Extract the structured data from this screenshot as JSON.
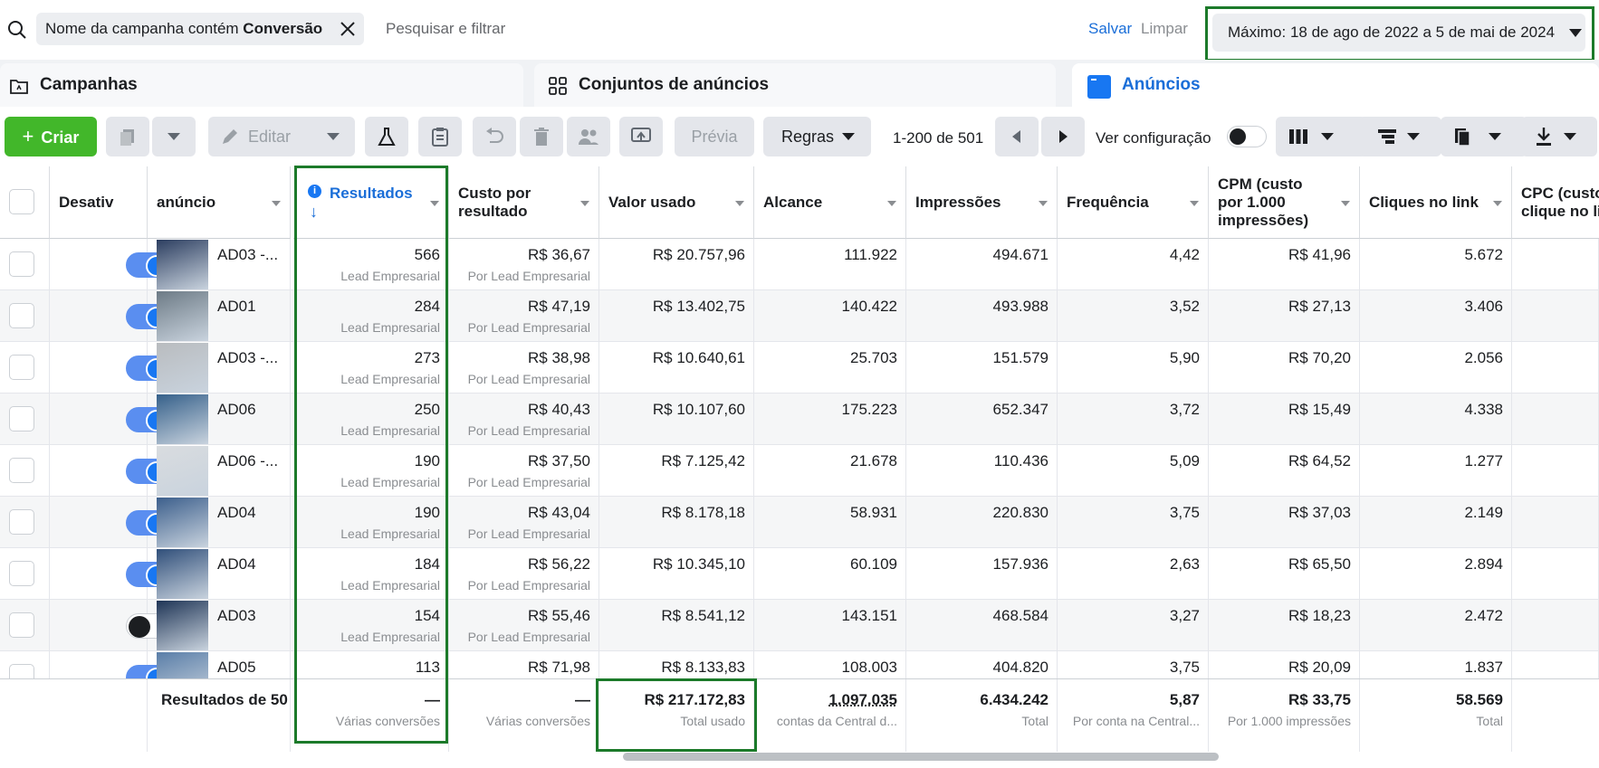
{
  "filter": {
    "chip_prefix": "Nome da campanha contém ",
    "chip_value": "Conversão",
    "search_placeholder": "Pesquisar e filtrar",
    "save": "Salvar",
    "clear": "Limpar",
    "date_range": "Máximo: 18 de ago de 2022 a 5 de mai de 2024"
  },
  "tabs": [
    {
      "label": "Campanhas",
      "icon": "folder-icon"
    },
    {
      "label": "Conjuntos de anúncios",
      "icon": "grid-icon"
    },
    {
      "label": "Anúncios",
      "icon": "ad-icon",
      "active": true
    }
  ],
  "toolbar": {
    "create": "Criar",
    "edit": "Editar",
    "preview": "Prévia",
    "rules": "Regras",
    "pager": "1-200 de 501",
    "view_settings": "Ver configuração"
  },
  "columns": {
    "toggle": "Desativ",
    "ad": "anúncio",
    "results": "Resultados",
    "cost_per_result_1": "Custo por",
    "cost_per_result_2": "resultado",
    "spent": "Valor usado",
    "reach": "Alcance",
    "impressions": "Impressões",
    "frequency": "Frequência",
    "cpm_1": "CPM (custo",
    "cpm_2": "por 1.000",
    "cpm_3": "impressões)",
    "link_clicks": "Cliques no link",
    "cpc_1": "CPC (custo",
    "cpc_2": "clique no li"
  },
  "rows": [
    {
      "on": true,
      "name": "AD03 -...",
      "results": "566",
      "results_sub": "Lead Empresarial",
      "cpr": "R$ 36,67",
      "cpr_sub": "Por Lead Empresarial",
      "spent": "R$ 20.757,96",
      "reach": "111.922",
      "impr": "494.671",
      "freq": "4,42",
      "cpm": "R$ 41,96",
      "clicks": "5.672"
    },
    {
      "on": true,
      "name": "AD01",
      "results": "284",
      "results_sub": "Lead Empresarial",
      "cpr": "R$ 47,19",
      "cpr_sub": "Por Lead Empresarial",
      "spent": "R$ 13.402,75",
      "reach": "140.422",
      "impr": "493.988",
      "freq": "3,52",
      "cpm": "R$ 27,13",
      "clicks": "3.406"
    },
    {
      "on": true,
      "name": "AD03 -...",
      "results": "273",
      "results_sub": "Lead Empresarial",
      "cpr": "R$ 38,98",
      "cpr_sub": "Por Lead Empresarial",
      "spent": "R$ 10.640,61",
      "reach": "25.703",
      "impr": "151.579",
      "freq": "5,90",
      "cpm": "R$ 70,20",
      "clicks": "2.056"
    },
    {
      "on": true,
      "name": "AD06",
      "results": "250",
      "results_sub": "Lead Empresarial",
      "cpr": "R$ 40,43",
      "cpr_sub": "Por Lead Empresarial",
      "spent": "R$ 10.107,60",
      "reach": "175.223",
      "impr": "652.347",
      "freq": "3,72",
      "cpm": "R$ 15,49",
      "clicks": "4.338"
    },
    {
      "on": true,
      "name": "AD06 -...",
      "results": "190",
      "results_sub": "Lead Empresarial",
      "cpr": "R$ 37,50",
      "cpr_sub": "Por Lead Empresarial",
      "spent": "R$ 7.125,42",
      "reach": "21.678",
      "impr": "110.436",
      "freq": "5,09",
      "cpm": "R$ 64,52",
      "clicks": "1.277"
    },
    {
      "on": true,
      "name": "AD04",
      "results": "190",
      "results_sub": "Lead Empresarial",
      "cpr": "R$ 43,04",
      "cpr_sub": "Por Lead Empresarial",
      "spent": "R$ 8.178,18",
      "reach": "58.931",
      "impr": "220.830",
      "freq": "3,75",
      "cpm": "R$ 37,03",
      "clicks": "2.149"
    },
    {
      "on": true,
      "name": "AD04",
      "results": "184",
      "results_sub": "Lead Empresarial",
      "cpr": "R$ 56,22",
      "cpr_sub": "Por Lead Empresarial",
      "spent": "R$ 10.345,10",
      "reach": "60.109",
      "impr": "157.936",
      "freq": "2,63",
      "cpm": "R$ 65,50",
      "clicks": "2.894"
    },
    {
      "on": false,
      "name": "AD03",
      "results": "154",
      "results_sub": "Lead Empresarial",
      "cpr": "R$ 55,46",
      "cpr_sub": "Por Lead Empresarial",
      "spent": "R$ 8.541,12",
      "reach": "143.151",
      "impr": "468.584",
      "freq": "3,27",
      "cpm": "R$ 18,23",
      "clicks": "2.472"
    },
    {
      "on": true,
      "name": "AD05",
      "results": "113",
      "results_sub": "",
      "cpr": "R$ 71,98",
      "cpr_sub": "",
      "spent": "R$ 8.133,83",
      "reach": "108.003",
      "impr": "404.820",
      "freq": "3,75",
      "cpm": "R$ 20,09",
      "clicks": "1.837"
    }
  ],
  "footer": {
    "label": "Resultados de 50",
    "results": "—",
    "results_sub": "Várias conversões",
    "cpr": "—",
    "cpr_sub": "Várias conversões",
    "spent": "R$ 217.172,83",
    "spent_sub": "Total usado",
    "reach": "1.097.035",
    "reach_sub": "contas da Central d...",
    "impr": "6.434.242",
    "impr_sub": "Total",
    "freq": "5,87",
    "freq_sub": "Por conta na Central...",
    "cpm": "R$ 33,75",
    "cpm_sub": "Por 1.000 impressões",
    "clicks": "58.569",
    "clicks_sub": "Total"
  },
  "colors": {
    "accent": "#1877f2",
    "create": "#42b72a",
    "highlight": "#1c7a2a"
  }
}
